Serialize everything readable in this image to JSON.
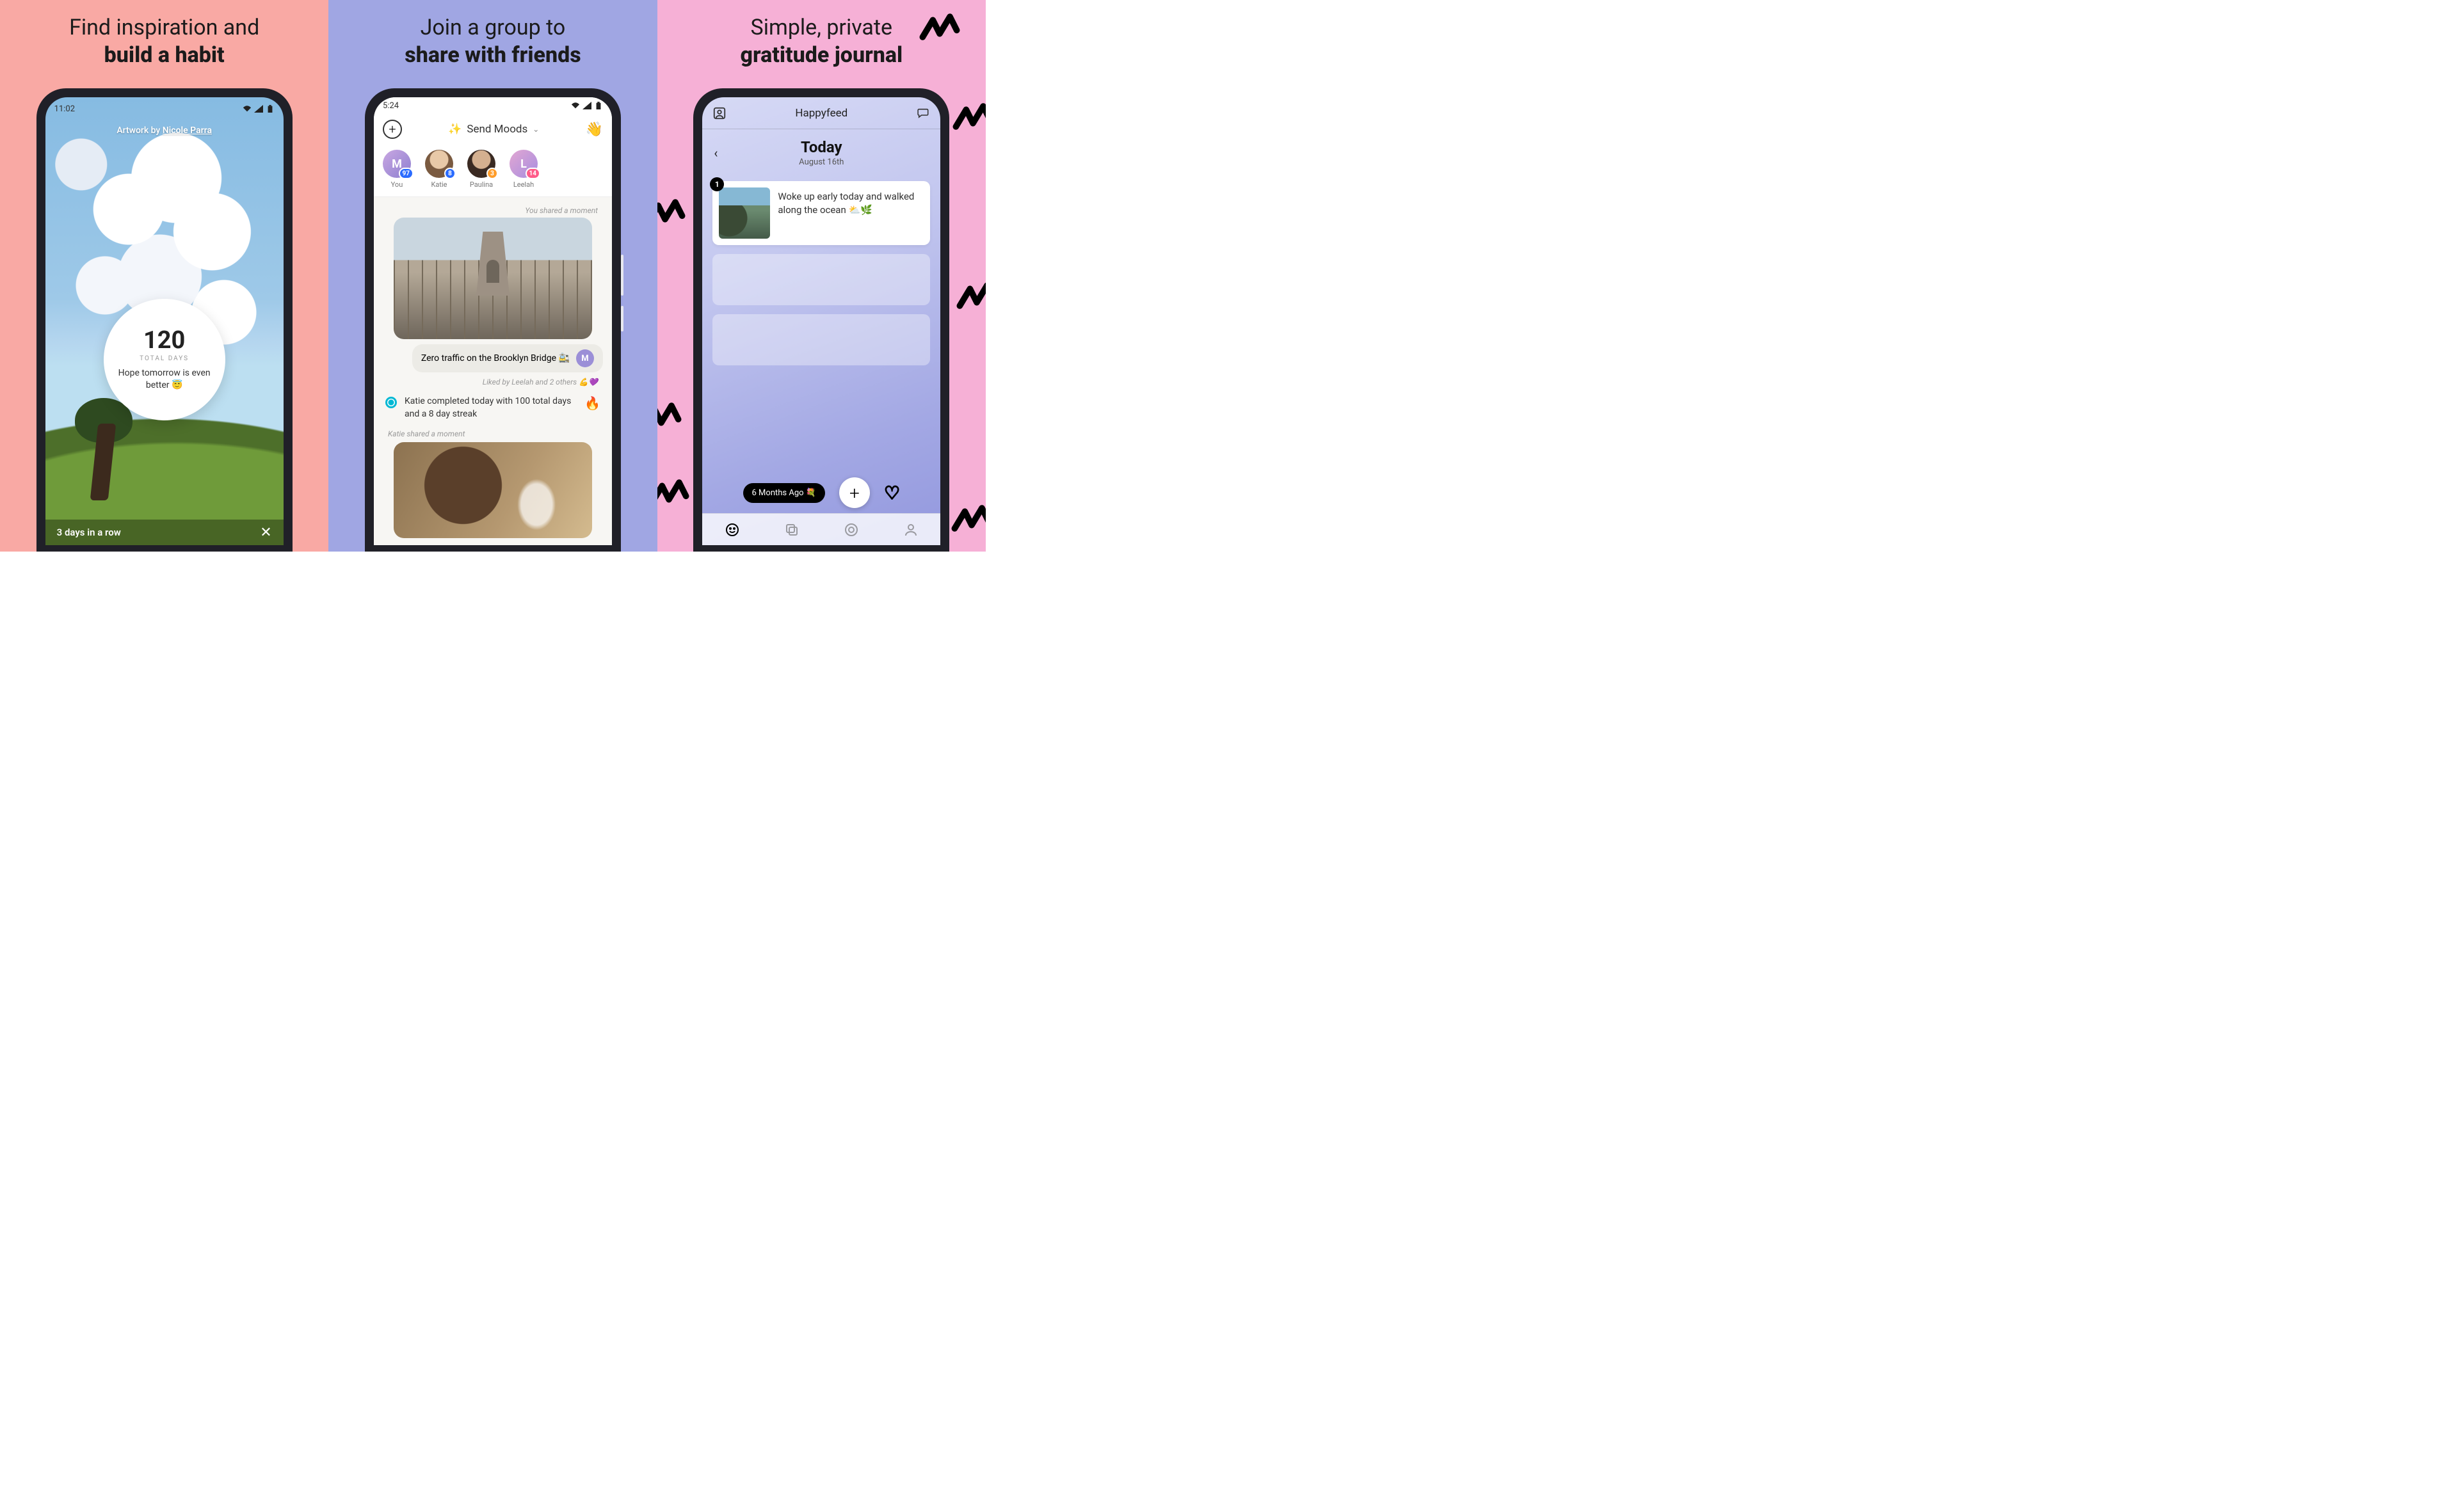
{
  "panel1": {
    "headline_top": "Find inspiration and",
    "headline_bold": "build a habit",
    "status_time": "11:02",
    "credit_prefix": "Artwork by ",
    "credit_artist": "Nicole Parra",
    "counter_number": "120",
    "counter_label": "TOTAL DAYS",
    "hope_text": "Hope tomorrow is even better 😇",
    "streak_text": "3 days in a row",
    "close_x": "✕"
  },
  "panel2": {
    "headline_top": "Join a group to",
    "headline_bold": "share with friends",
    "status_time": "5:24",
    "title_emoji": "✨",
    "title_text": "Send Moods",
    "wave_emoji": "👋",
    "avatars": [
      {
        "initial": "M",
        "name": "You",
        "color": "#9b8fd7",
        "badge": "97",
        "badge_color": "#2b6cff"
      },
      {
        "initial": "",
        "name": "Katie",
        "color": "#d2a37a",
        "badge": "8",
        "badge_color": "#2b6cff",
        "photo": true
      },
      {
        "initial": "",
        "name": "Paulina",
        "color": "#b88d8d",
        "badge": "3",
        "badge_color": "#ff9d2b",
        "photo": true
      },
      {
        "initial": "L",
        "name": "Leelah",
        "color": "#c9a7e2",
        "badge": "14",
        "badge_color": "#ff5c8a"
      }
    ],
    "shared_label": "You shared a moment",
    "caption": "Zero traffic on the Brooklyn Bridge 🚉",
    "caption_initial": "M",
    "liked_text": "Liked by Leelah and 2 others 💪💜",
    "milestone_text": "Katie completed today with 100 total days and a 8 day streak",
    "fire_emoji": "🔥",
    "shared2_label": "Katie shared a moment"
  },
  "panel3": {
    "headline_top": "Simple, private",
    "headline_bold": "gratitude journal",
    "app_title": "Happyfeed",
    "today_label": "Today",
    "date_label": "August 16th",
    "entry_badge": "1",
    "entry_text": "Woke up early today and walked along the ocean ⛅🌿",
    "chip_label": "6 Months Ago 💐",
    "fab_plus": "+"
  }
}
